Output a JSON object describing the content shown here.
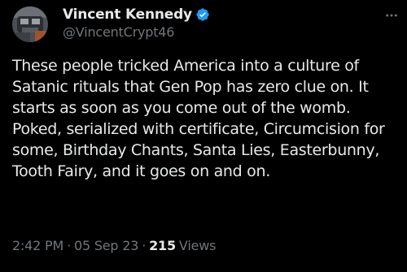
{
  "author": {
    "display_name": "Vincent Kennedy",
    "handle": "@VincentCrypt46",
    "verified_icon": "verified-badge-icon",
    "verified_color": "#1d9bf0"
  },
  "tweet": {
    "text": "These people tricked America into a culture of Satanic rituals that Gen Pop has zero clue on. It starts as soon as you come out of the womb. Poked, serialized with certificate, Circumcision for some, Birthday Chants, Santa Lies, Easterbunny, Tooth Fairy, and it goes on and on."
  },
  "meta": {
    "time": "2:42 PM",
    "separator": "·",
    "date": "05 Sep 23",
    "views_count": "215",
    "views_label": "Views"
  },
  "colors": {
    "background": "#000000",
    "text_primary": "#e7e9ea",
    "text_secondary": "#71767b"
  }
}
